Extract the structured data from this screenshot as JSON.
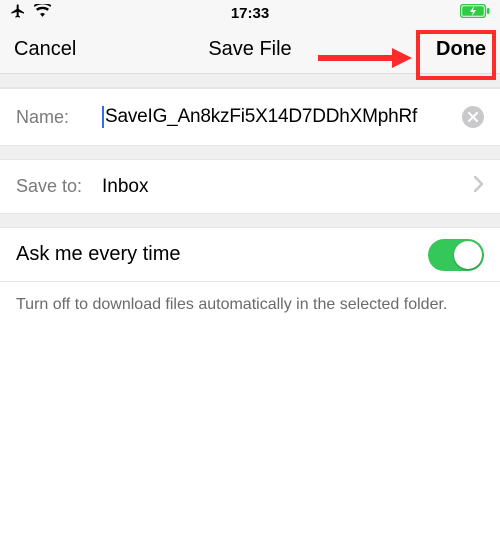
{
  "status": {
    "time": "17:33"
  },
  "nav": {
    "cancel": "Cancel",
    "title": "Save File",
    "done": "Done"
  },
  "name": {
    "label": "Name:",
    "value": "SaveIG_An8kzFi5X14D7DDhXMphRf"
  },
  "saveto": {
    "label": "Save to:",
    "value": "Inbox"
  },
  "toggle": {
    "label": "Ask me every time",
    "on": true
  },
  "helper": "Turn off to download files automatically in the selected folder."
}
